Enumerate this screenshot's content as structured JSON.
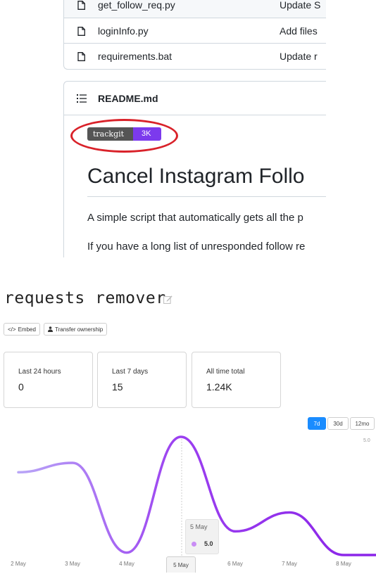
{
  "files": [
    {
      "name": "get_follow_req.py",
      "commit": "Update S"
    },
    {
      "name": "loginInfo.py",
      "commit": "Add files"
    },
    {
      "name": "requirements.bat",
      "commit": "Update r"
    }
  ],
  "readme": {
    "title": "README.md",
    "badge_label": "trackgit",
    "badge_value": "3K",
    "heading": "Cancel Instagram Follo",
    "para1": "A simple script that automatically gets all the p",
    "para2": "If you have a long list of unresponded follow re"
  },
  "tracker": {
    "repo_title": "requests remover",
    "embed_label": "Embed",
    "transfer_label": "Transfer ownership",
    "stats": [
      {
        "label": "Last 24 hours",
        "value": "0"
      },
      {
        "label": "Last 7 days",
        "value": "15"
      },
      {
        "label": "All time total",
        "value": "1.24K"
      }
    ],
    "ranges": [
      "7d",
      "30d",
      "12mo"
    ],
    "active_range": "7d",
    "tooltip": {
      "date": "5 May",
      "value": "5.0"
    }
  },
  "colors": {
    "accent": "#1a8cff",
    "line_start": "#b9a6f7",
    "line_end": "#8a23e8",
    "badge": "#7c3aed",
    "highlight_circle": "#d9222a"
  },
  "chart_data": {
    "type": "line",
    "x": [
      "2 May",
      "3 May",
      "4 May",
      "5 May",
      "6 May",
      "7 May",
      "8 May"
    ],
    "series": [
      {
        "values": [
          3.5,
          3.9,
          0.1,
          5.0,
          1.0,
          1.8,
          0.0
        ]
      }
    ],
    "ylim": [
      0,
      5
    ],
    "y_ticks": [
      "5.0"
    ],
    "highlighted": "5 May"
  }
}
